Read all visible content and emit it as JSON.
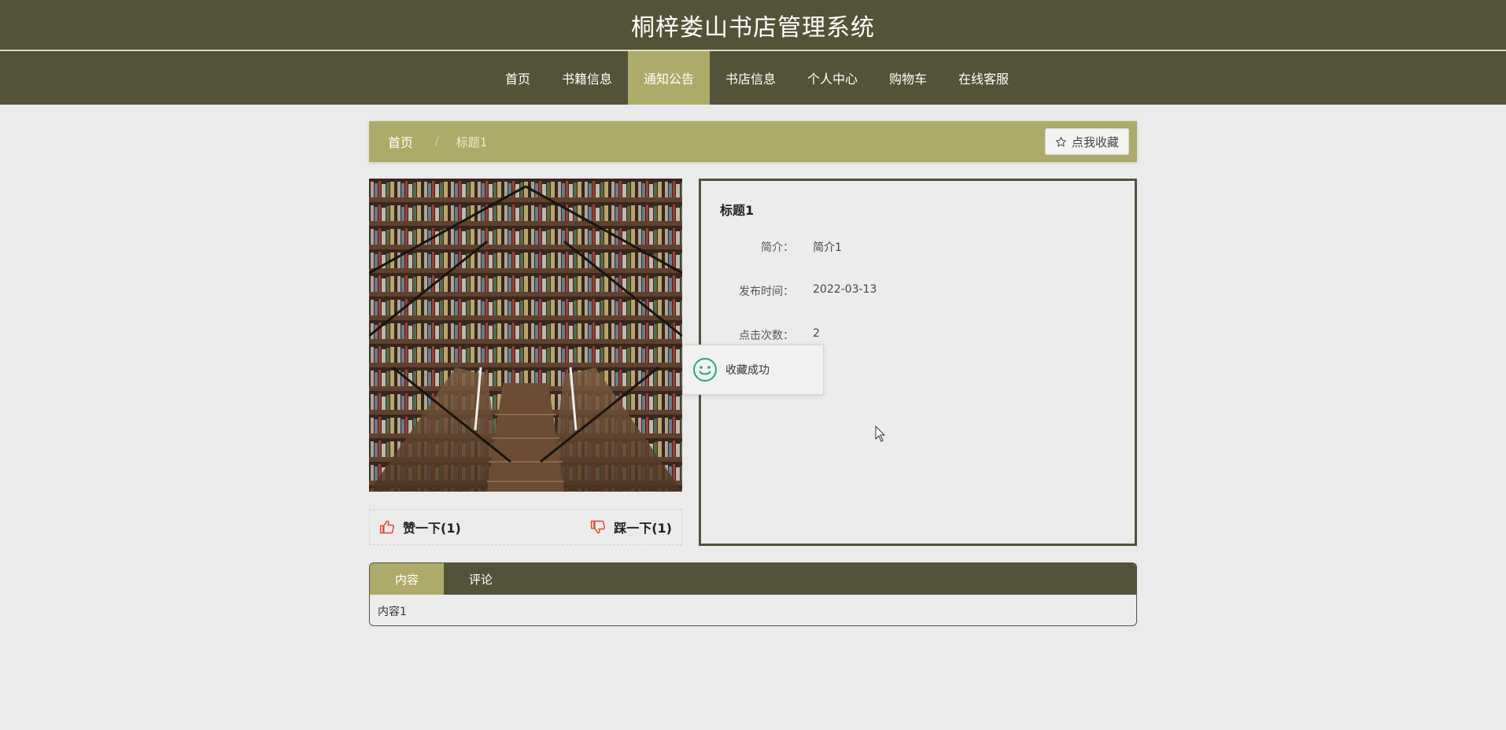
{
  "header": {
    "site_title": "桐梓娄山书店管理系统"
  },
  "nav": {
    "items": [
      {
        "label": "首页",
        "active": false
      },
      {
        "label": "书籍信息",
        "active": false
      },
      {
        "label": "通知公告",
        "active": true
      },
      {
        "label": "书店信息",
        "active": false
      },
      {
        "label": "个人中心",
        "active": false
      },
      {
        "label": "购物车",
        "active": false
      },
      {
        "label": "在线客服",
        "active": false
      }
    ]
  },
  "breadcrumb": {
    "home": "首页",
    "separator": "/",
    "current": "标题1"
  },
  "favorite_button": {
    "label": "点我收藏",
    "icon": "star-outline-icon"
  },
  "votes": {
    "like": {
      "label": "赞一下(1)",
      "icon": "thumbs-up-icon"
    },
    "dislike": {
      "label": "踩一下(1)",
      "icon": "thumbs-down-icon"
    }
  },
  "detail": {
    "title": "标题1",
    "fields": [
      {
        "label": "简介：",
        "value": "简介1"
      },
      {
        "label": "发布时间：",
        "value": "2022-03-13"
      },
      {
        "label": "点击次数：",
        "value": "2"
      }
    ]
  },
  "toast": {
    "message": "收藏成功",
    "icon": "smiley-icon"
  },
  "tabs": {
    "items": [
      {
        "label": "内容",
        "active": true
      },
      {
        "label": "评论",
        "active": false
      }
    ],
    "content": "内容1"
  },
  "colors": {
    "header_bg": "#545339",
    "accent": "#aeab6a",
    "page_bg": "#ebebeb",
    "like_icon": "#e2452d",
    "toast_icon": "#2aa876"
  }
}
